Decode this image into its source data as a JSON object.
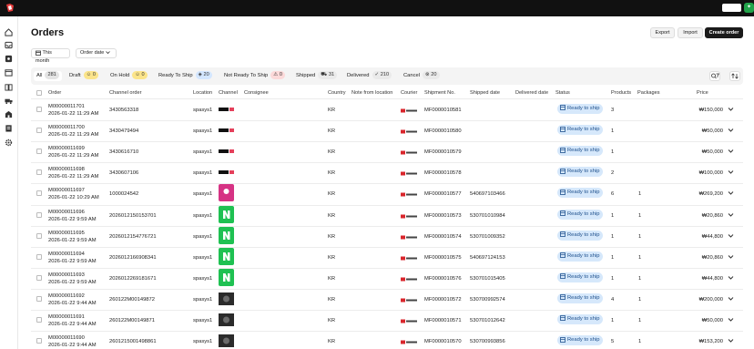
{
  "page": {
    "title": "Orders",
    "export_label": "Export",
    "import_label": "Import",
    "create_label": "Create order",
    "period_label": "This month",
    "sort_label": "Order date"
  },
  "tabs": [
    {
      "label": "All",
      "count": "281"
    },
    {
      "label": "Draft",
      "count": "0"
    },
    {
      "label": "On Hold",
      "count": "0"
    },
    {
      "label": "Ready To Ship",
      "count": "20"
    },
    {
      "label": "Not Ready To Ship",
      "count": "0"
    },
    {
      "label": "Shipped",
      "count": "31"
    },
    {
      "label": "Delivered",
      "count": "210"
    },
    {
      "label": "Cancel",
      "count": "20"
    }
  ],
  "columns": [
    "Order",
    "Channel order",
    "Location",
    "Channel",
    "Consignee",
    "Country",
    "Note from location",
    "Courier",
    "Shipment No.",
    "Shipped date",
    "Delivered date",
    "Status",
    "Products",
    "Packages",
    "Price"
  ],
  "rows": [
    {
      "order": "M00000011701",
      "date": "2026-01-22 11:29 AM",
      "channel_order": "3430563318",
      "location": "spasys1",
      "channel": "gs",
      "country": "KR",
      "shipment": "MF0000010581",
      "shipped": "",
      "status": "Ready to ship",
      "products": "3",
      "packages": "",
      "price": "₩150,000"
    },
    {
      "order": "M00000011700",
      "date": "2026-01-22 11:29 AM",
      "channel_order": "3430479494",
      "location": "spasys1",
      "channel": "gs",
      "country": "KR",
      "shipment": "MF0000010580",
      "shipped": "",
      "status": "Ready to ship",
      "products": "1",
      "packages": "",
      "price": "₩50,000"
    },
    {
      "order": "M00000011699",
      "date": "2026-01-22 11:29 AM",
      "channel_order": "3430616710",
      "location": "spasys1",
      "channel": "gs",
      "country": "KR",
      "shipment": "MF0000010579",
      "shipped": "",
      "status": "Ready to ship",
      "products": "1",
      "packages": "",
      "price": "₩50,000"
    },
    {
      "order": "M00000011698",
      "date": "2026-01-22 11:29 AM",
      "channel_order": "3430607106",
      "location": "spasys1",
      "channel": "gs",
      "country": "KR",
      "shipment": "MF0000010578",
      "shipped": "",
      "status": "Ready to ship",
      "products": "2",
      "packages": "",
      "price": "₩100,000"
    },
    {
      "order": "M00000011697",
      "date": "2026-01-22 10:29 AM",
      "channel_order": "1000024542",
      "location": "spasys1",
      "channel": "pink",
      "country": "KR",
      "shipment": "MF0000010577",
      "shipped": "540697103466",
      "status": "Ready to ship",
      "products": "6",
      "packages": "1",
      "price": "₩269,200"
    },
    {
      "order": "M00000011696",
      "date": "2026-01-22 9:59 AM",
      "channel_order": "2026012150153701",
      "location": "spasys1",
      "channel": "naver",
      "country": "KR",
      "shipment": "MF0000010573",
      "shipped": "530701010984",
      "status": "Ready to ship",
      "products": "1",
      "packages": "1",
      "price": "₩20,860"
    },
    {
      "order": "M00000011695",
      "date": "2026-01-22 9:59 AM",
      "channel_order": "2026012154776721",
      "location": "spasys1",
      "channel": "naver",
      "country": "KR",
      "shipment": "MF0000010574",
      "shipped": "530701009352",
      "status": "Ready to ship",
      "products": "1",
      "packages": "1",
      "price": "₩44,800"
    },
    {
      "order": "M00000011694",
      "date": "2026-01-22 9:59 AM",
      "channel_order": "2026012166908341",
      "location": "spasys1",
      "channel": "naver",
      "country": "KR",
      "shipment": "MF0000010575",
      "shipped": "540697124153",
      "status": "Ready to ship",
      "products": "1",
      "packages": "1",
      "price": "₩20,860"
    },
    {
      "order": "M00000011693",
      "date": "2026-01-22 9:59 AM",
      "channel_order": "2026012269181671",
      "location": "spasys1",
      "channel": "naver",
      "country": "KR",
      "shipment": "MF0000010576",
      "shipped": "530701015405",
      "status": "Ready to ship",
      "products": "1",
      "packages": "1",
      "price": "₩44,800"
    },
    {
      "order": "M00000011692",
      "date": "2026-01-22 9:44 AM",
      "channel_order": "260122M00149872",
      "location": "spasys1",
      "channel": "dark",
      "country": "KR",
      "shipment": "MF0000010572",
      "shipped": "530700992574",
      "status": "Ready to ship",
      "products": "4",
      "packages": "1",
      "price": "₩200,000"
    },
    {
      "order": "M00000011691",
      "date": "2026-01-22 9:44 AM",
      "channel_order": "260122M00149871",
      "location": "spasys1",
      "channel": "dark",
      "country": "KR",
      "shipment": "MF0000010571",
      "shipped": "530701012642",
      "status": "Ready to ship",
      "products": "1",
      "packages": "1",
      "price": "₩50,000"
    },
    {
      "order": "M00000011690",
      "date": "2026-01-22 9:44 AM",
      "channel_order": "2601215001498861",
      "location": "spasys1",
      "channel": "dark",
      "country": "KR",
      "shipment": "MF0000010570",
      "shipped": "530700993856",
      "status": "Ready to ship",
      "products": "5",
      "packages": "1",
      "price": "₩153,200"
    }
  ]
}
